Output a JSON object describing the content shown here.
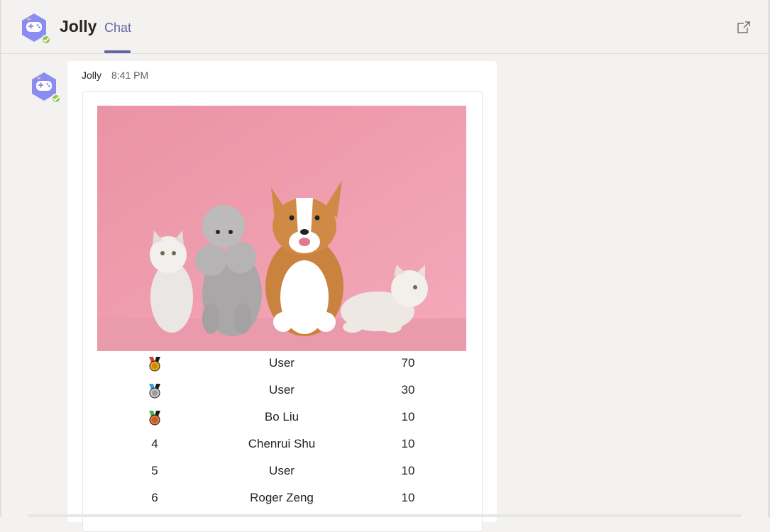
{
  "header": {
    "app_name": "Jolly",
    "tab_label": "Chat",
    "avatar_icon": "game-controller-icon",
    "popout_icon": "pop-out-icon"
  },
  "message": {
    "sender": "Jolly",
    "time": "8:41 PM"
  },
  "card": {
    "image_icon": "pets-photo",
    "leaderboard": [
      {
        "rank": "",
        "medal": "gold",
        "name": "User",
        "score": "70"
      },
      {
        "rank": "",
        "medal": "silver",
        "name": "User",
        "score": "30"
      },
      {
        "rank": "",
        "medal": "bronze",
        "name": "Bo Liu",
        "score": "10"
      },
      {
        "rank": "4",
        "medal": "",
        "name": "Chenrui Shu",
        "score": "10"
      },
      {
        "rank": "5",
        "medal": "",
        "name": "User",
        "score": "10"
      },
      {
        "rank": "6",
        "medal": "",
        "name": "Roger Zeng",
        "score": "10"
      }
    ]
  },
  "colors": {
    "accent": "#6264a7",
    "status_available": "#92c353",
    "background": "#f3f2f1"
  }
}
